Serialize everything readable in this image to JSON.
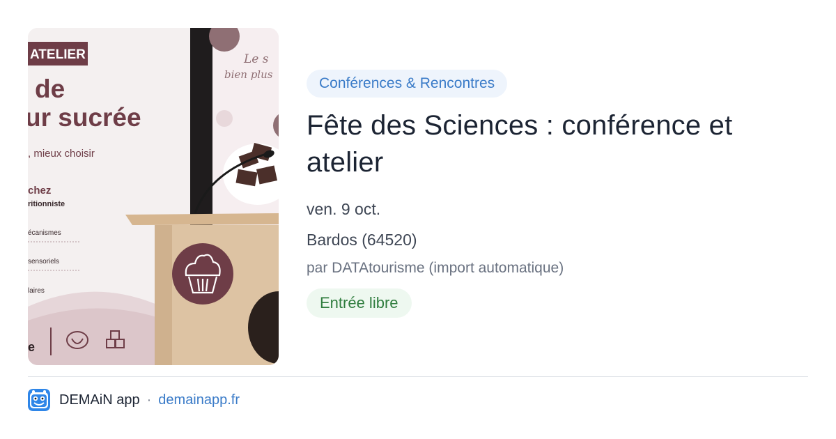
{
  "image": {
    "alt_texts": {
      "banner": "ATELIER",
      "heading_line1": "de",
      "heading_line2": "ur sucrée",
      "subtitle": ", mieux choisir",
      "speaker": "chez",
      "speaker_role": "ritionniste",
      "bullet1": "écanismes",
      "bullet2": "sensoriels",
      "bullet3": "laires",
      "screen_script_1": "Le s",
      "screen_script_2": "bien plus",
      "footer_letter": "e"
    },
    "accent_color": "#6e3d47"
  },
  "event": {
    "category": "Conférences & Rencontres",
    "title": "Fête des Sciences : conférence et atelier",
    "date": "ven. 9 oct.",
    "place": "Bardos (64520)",
    "author": "par DATAtourisme (import automatique)",
    "price_badge": "Entrée libre"
  },
  "colors": {
    "category_bg": "#eef4fc",
    "category_text": "#3a7bc8",
    "badge_bg": "#eef8f0",
    "badge_text": "#2f7d3e",
    "title_text": "#1c2433"
  },
  "footer": {
    "app_name": "DEMAiN app",
    "separator": "·",
    "link": "demainapp.fr",
    "icon": "demain-app-logo-icon"
  }
}
